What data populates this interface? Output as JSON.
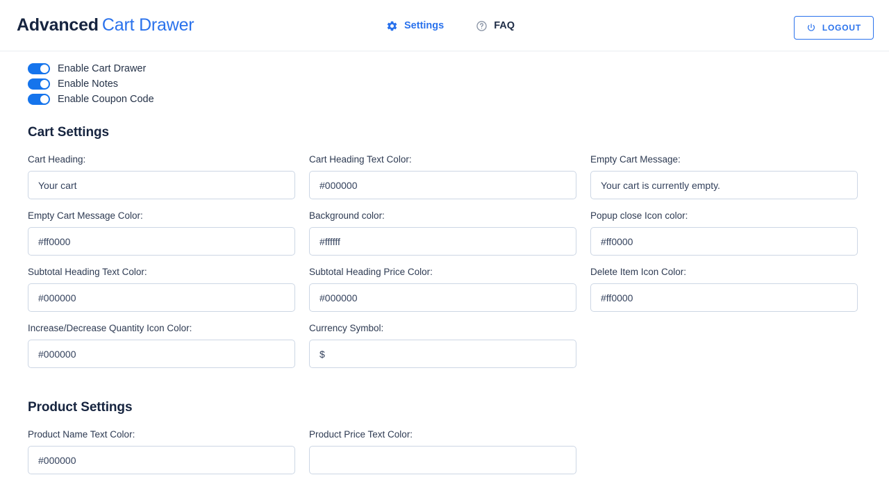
{
  "header": {
    "brand_strong": "Advanced",
    "brand_light": "Cart Drawer",
    "nav": [
      {
        "label": "Settings",
        "icon": "gear-icon",
        "active": true
      },
      {
        "label": "FAQ",
        "icon": "question-circle-icon",
        "active": false
      }
    ],
    "logout_label": "LOGOUT",
    "logout_icon": "power-icon"
  },
  "toggles": [
    {
      "label": "Enable Cart Drawer",
      "on": true
    },
    {
      "label": "Enable Notes",
      "on": true
    },
    {
      "label": "Enable Coupon Code",
      "on": true
    }
  ],
  "cart_settings": {
    "title": "Cart Settings",
    "fields": [
      {
        "label": "Cart Heading:",
        "value": "Your cart"
      },
      {
        "label": "Cart Heading Text Color:",
        "value": "#000000"
      },
      {
        "label": "Empty Cart Message:",
        "value": "Your cart is currently empty."
      },
      {
        "label": "Empty Cart Message Color:",
        "value": "#ff0000"
      },
      {
        "label": "Background color:",
        "value": "#ffffff"
      },
      {
        "label": "Popup close Icon color:",
        "value": "#ff0000"
      },
      {
        "label": "Subtotal Heading Text Color:",
        "value": "#000000"
      },
      {
        "label": "Subtotal Heading Price Color:",
        "value": "#000000"
      },
      {
        "label": "Delete Item Icon Color:",
        "value": "#ff0000"
      },
      {
        "label": "Increase/Decrease Quantity Icon Color:",
        "value": "#000000"
      },
      {
        "label": "Currency Symbol:",
        "value": "$"
      }
    ]
  },
  "product_settings": {
    "title": "Product Settings",
    "fields": [
      {
        "label": "Product Name Text Color:",
        "value": "#000000"
      },
      {
        "label": "Product Price Text Color:",
        "value": ""
      }
    ]
  },
  "colors": {
    "accent_blue": "#2a72ec",
    "brand_dark": "#16243f",
    "toggle_on": "#1574ec",
    "input_border": "#ccd6e4"
  }
}
